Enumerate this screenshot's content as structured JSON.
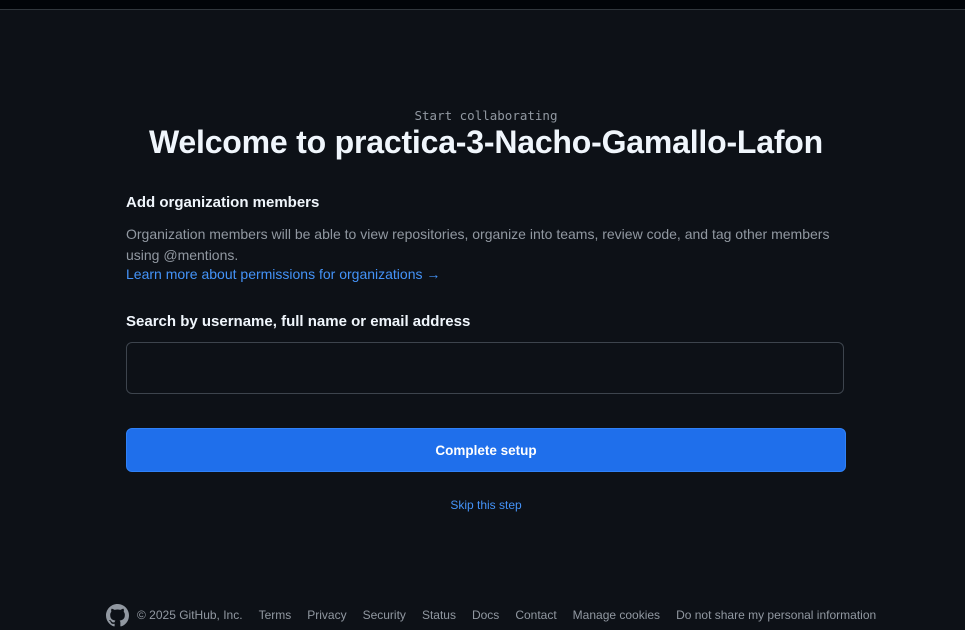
{
  "header": {
    "eyebrow": "Start collaborating",
    "title": "Welcome to practica-3-Nacho-Gamallo-Lafon"
  },
  "members": {
    "heading": "Add organization members",
    "description": "Organization members will be able to view repositories, organize into teams, review code, and tag other members using @mentions.",
    "learn_more": "Learn more about permissions for organizations →"
  },
  "search": {
    "label": "Search by username, full name or email address",
    "value": "",
    "placeholder": ""
  },
  "actions": {
    "complete_label": "Complete setup",
    "skip_label": "Skip this step"
  },
  "footer": {
    "logo_icon": "github-mark-icon",
    "copyright": "© 2025 GitHub, Inc.",
    "links": [
      "Terms",
      "Privacy",
      "Security",
      "Status",
      "Docs",
      "Contact",
      "Manage cookies",
      "Do not share my personal information"
    ]
  },
  "colors": {
    "background": "#0d1117",
    "primary_button": "#1f6feb",
    "link": "#4493f8",
    "muted_text": "#9198a1"
  }
}
